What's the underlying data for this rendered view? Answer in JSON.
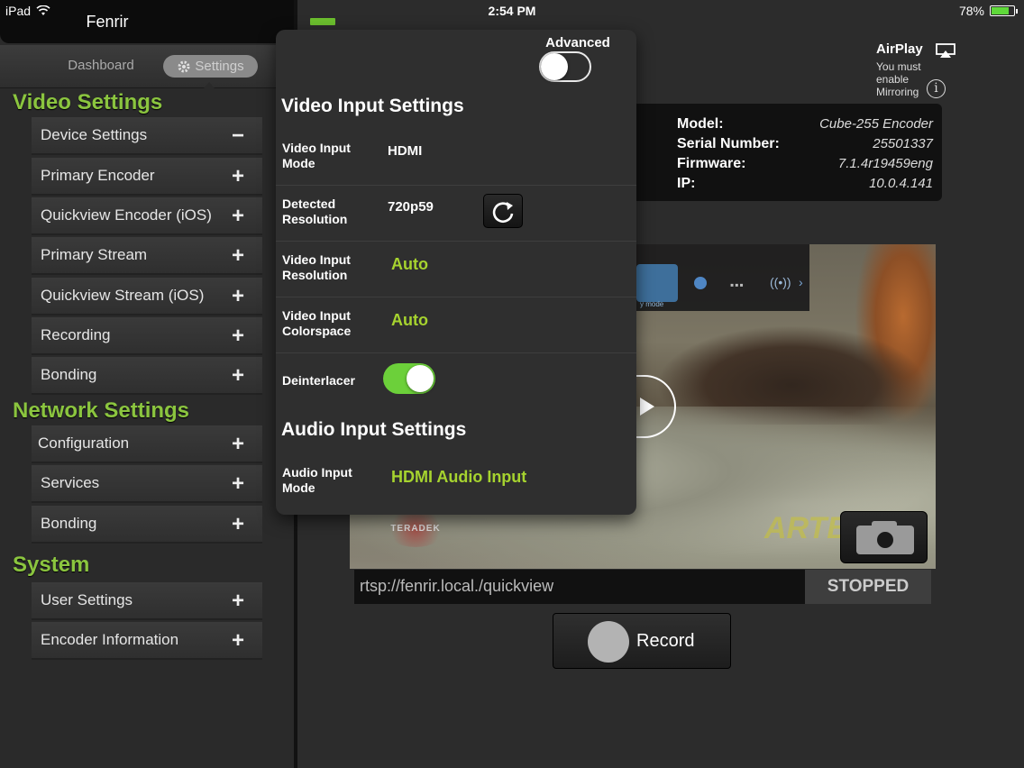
{
  "status_bar": {
    "carrier": "iPad",
    "time": "2:54 PM",
    "battery_percent": "78%",
    "battery_level": 0.78
  },
  "sidebar": {
    "title": "Fenrir",
    "segments": {
      "dashboard": "Dashboard",
      "settings": "Settings"
    },
    "sections": [
      {
        "title": "Video Settings"
      },
      {
        "title": "Network Settings"
      },
      {
        "title": "System"
      }
    ],
    "video_items": [
      "Device Settings",
      "Primary Encoder",
      "Quickview Encoder (iOS)",
      "Primary Stream",
      "Quickview Stream (iOS)",
      "Recording",
      "Bonding"
    ],
    "network_items": [
      "Configuration",
      "Services",
      "Bonding"
    ],
    "system_items": [
      "User Settings",
      "Encoder Information"
    ],
    "expand_glyph": "+",
    "collapse_glyph": "−"
  },
  "airplay": {
    "title": "AirPlay",
    "note_1": "You must",
    "note_2": "enable",
    "note_3": "Mirroring",
    "info_glyph": "i"
  },
  "device_info": {
    "model_label": "Model:",
    "model": "Cube-255 Encoder",
    "serial_label": "Serial Number:",
    "serial": "25501337",
    "firmware_label": "Firmware:",
    "firmware": "7.1.4r19459eng",
    "ip_label": "IP:",
    "ip": "10.0.4.141"
  },
  "video_preview": {
    "watermark": "ARTB",
    "logo": "TERADEK",
    "overlay_caption": "y mode"
  },
  "stream": {
    "url": "rtsp://fenrir.local./quickview",
    "status": "STOPPED",
    "record_label": "Record"
  },
  "popover": {
    "advanced_label": "Advanced",
    "advanced_on": false,
    "video_heading": "Video Input Settings",
    "rows": [
      {
        "label_1": "Video Input",
        "label_2": "Mode",
        "value": "HDMI"
      },
      {
        "label_1": "Detected",
        "label_2": "Resolution",
        "value": "720p59"
      },
      {
        "label_1": "Video Input",
        "label_2": "Resolution",
        "value": "Auto"
      },
      {
        "label_1": "Video Input",
        "label_2": "Colorspace",
        "value": "Auto"
      }
    ],
    "deinterlacer_label": "Deinterlacer",
    "deinterlacer_on": true,
    "audio_heading": "Audio Input Settings",
    "audio_row": {
      "label_1": "Audio Input",
      "label_2": "Mode",
      "value": "HDMI Audio Input"
    }
  },
  "icons": {
    "wifi": "wifi-icon",
    "battery": "battery-icon",
    "gear": "gear-icon",
    "airplay": "airplay-icon",
    "info": "info-icon",
    "refresh": "refresh-icon",
    "camera": "camera-icon",
    "record": "record-icon",
    "play": "play-icon"
  },
  "colors": {
    "accent_green": "#8bc53f",
    "value_green": "#a6d32f",
    "toggle_on": "#6cd03a"
  }
}
